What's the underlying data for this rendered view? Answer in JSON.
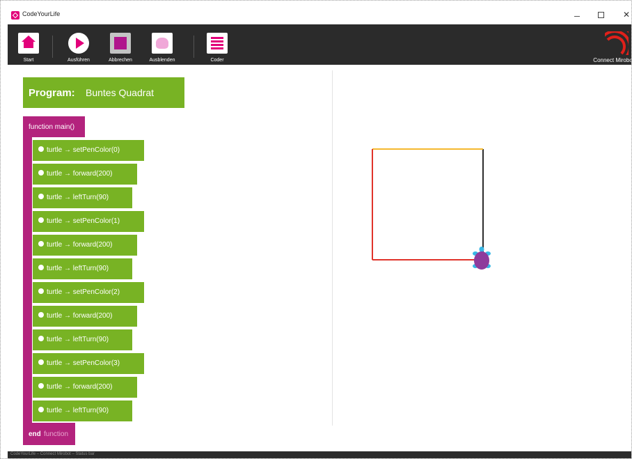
{
  "app": {
    "title": "CodeYourLife",
    "window_controls": {
      "minimize": "minimize",
      "maximize": "maximize",
      "close": "✕"
    }
  },
  "toolbar": {
    "tools": [
      {
        "label": "Start",
        "icon": "home-icon"
      },
      {
        "label": "Ausführen",
        "icon": "play-icon"
      },
      {
        "label": "Abbrechen",
        "icon": "stop-icon"
      },
      {
        "label": "Ausblenden",
        "icon": "turtle-icon"
      },
      {
        "label": "Coder",
        "icon": "code-list-icon"
      }
    ],
    "connect_label": "Connect Mirobot",
    "connect_icon": "wireless-signal-icon"
  },
  "program": {
    "label": "Program:",
    "name": "Buntes Quadrat"
  },
  "function": {
    "header": "function main()",
    "end_keyword": "end",
    "end_rest": "function",
    "statements": [
      "turtle → setPenColor(0)",
      "turtle → forward(200)",
      "turtle → leftTurn(90)",
      "turtle → setPenColor(1)",
      "turtle → forward(200)",
      "turtle → leftTurn(90)",
      "turtle → setPenColor(2)",
      "turtle → forward(200)",
      "turtle → leftTurn(90)",
      "turtle → setPenColor(3)",
      "turtle → forward(200)",
      "turtle → leftTurn(90)"
    ]
  },
  "canvas": {
    "pen_colors": [
      "#e0332a",
      "#2c2c2c",
      "#f5b82e",
      "#e0332a"
    ],
    "turtle_color": "#8e3b9c",
    "turtle_limb_color": "#39b7e5"
  },
  "colors": {
    "toolbar_bg": "#2b2b2b",
    "accent": "#e2007a",
    "function_block": "#b3237d",
    "statement_block": "#78b324"
  },
  "status": {
    "text": "CodeYourLife – Connect Mirobot – Status bar"
  }
}
